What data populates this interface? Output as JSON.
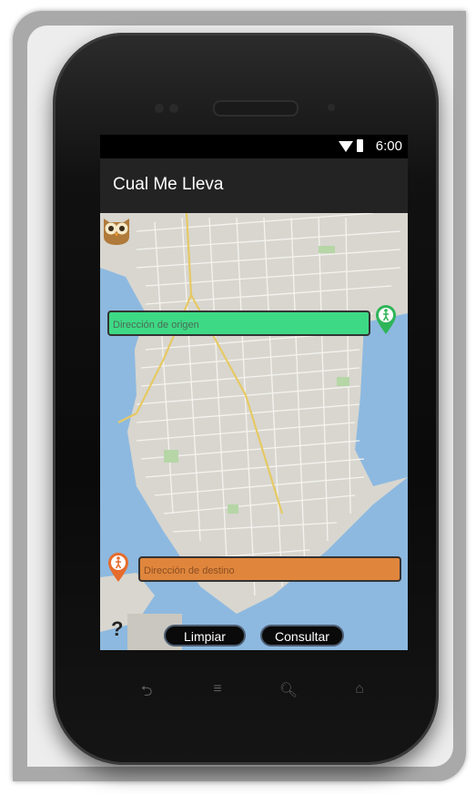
{
  "status_bar": {
    "time": "6:00"
  },
  "app": {
    "title": "Cual Me Lleva"
  },
  "origin": {
    "placeholder": "Dirección de origen"
  },
  "destination": {
    "placeholder": "Dirección de destino"
  },
  "buttons": {
    "clear_label": "Limpiar",
    "query_label": "Consultar",
    "help_label": "?"
  },
  "icons": {
    "origin_pin": "walking-person-pin-icon",
    "destination_pin": "walking-person-pin-icon",
    "owl": "owl-logo-icon",
    "nav_back": "back-icon",
    "nav_menu": "menu-icon",
    "nav_search": "search-icon",
    "nav_home": "home-icon"
  },
  "colors": {
    "origin_field": "#3ed985",
    "destination_field": "#e0863c",
    "water": "#8db9e0",
    "pin_green": "#2fb559",
    "pin_orange": "#e56c2d"
  }
}
